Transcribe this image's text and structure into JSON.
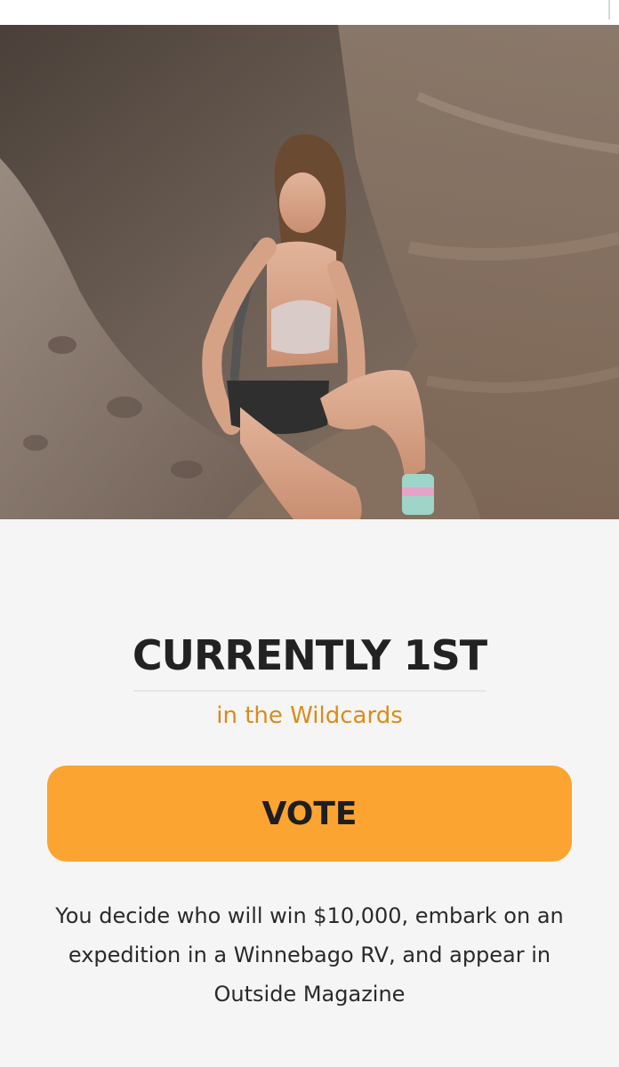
{
  "contest": {
    "rank_label": "CURRENTLY 1ST",
    "category_label": "in the Wildcards",
    "vote_label": "VOTE",
    "description": "You decide who will win $10,000, embark on an expedition in a Winnebago RV, and appear in Outside Magazine"
  },
  "colors": {
    "accent": "#fba431",
    "category_text": "#d98c1c",
    "background": "#f5f5f5"
  }
}
